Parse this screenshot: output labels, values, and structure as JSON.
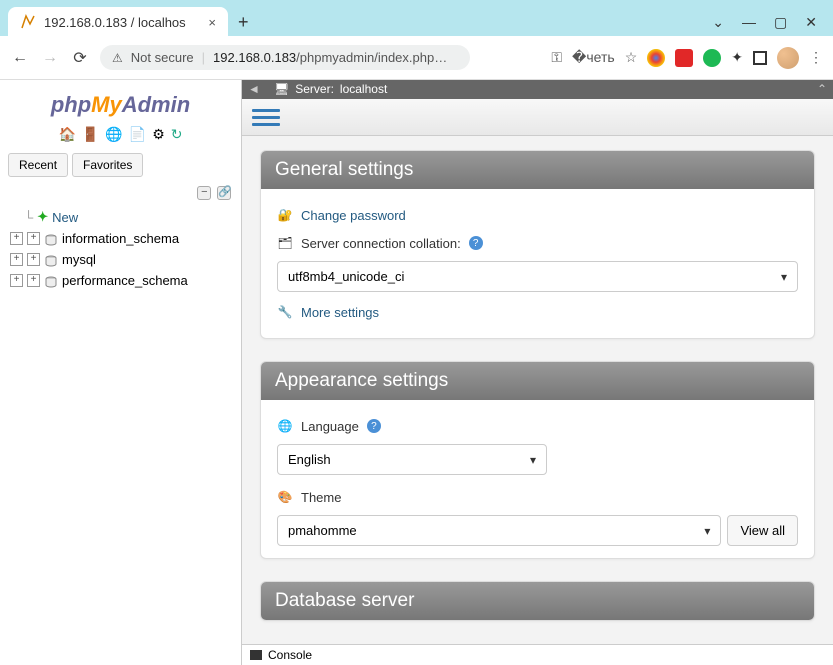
{
  "browser": {
    "tab_title": "192.168.0.183 / localhos",
    "url_insecure_label": "Not secure",
    "url_host": "192.168.0.183",
    "url_path": "/phpmyadmin/index.php…"
  },
  "sidebar": {
    "logo": {
      "part1": "php",
      "part2": "My",
      "part3": "Admin"
    },
    "tabs": {
      "recent": "Recent",
      "favorites": "Favorites"
    },
    "new_label": "New",
    "databases": [
      {
        "name": "information_schema"
      },
      {
        "name": "mysql"
      },
      {
        "name": "performance_schema"
      }
    ]
  },
  "server_bar": {
    "label": "Server:",
    "value": "localhost"
  },
  "panels": {
    "general": {
      "title": "General settings",
      "change_password": "Change password",
      "collation_label": "Server connection collation:",
      "collation_value": "utf8mb4_unicode_ci",
      "more_settings": "More settings"
    },
    "appearance": {
      "title": "Appearance settings",
      "language_label": "Language",
      "language_value": "English",
      "theme_label": "Theme",
      "theme_value": "pmahomme",
      "view_all": "View all"
    },
    "dbserver": {
      "title": "Database server"
    }
  },
  "console": {
    "label": "Console"
  }
}
